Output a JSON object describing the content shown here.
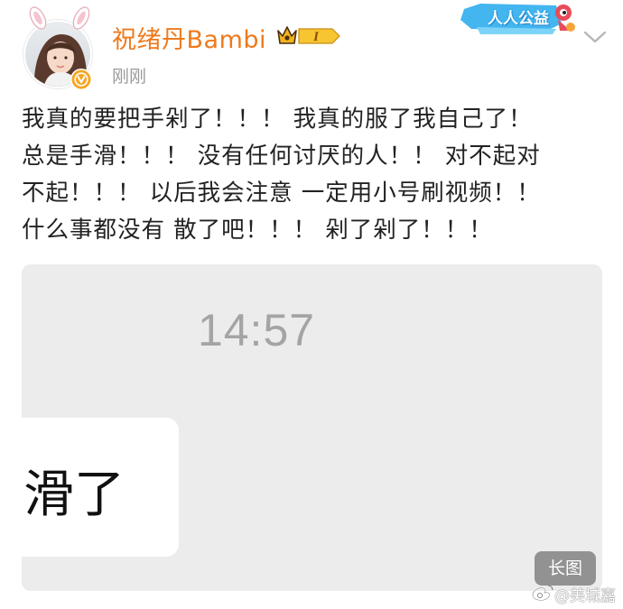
{
  "post": {
    "author": {
      "username": "祝绪丹Bambi",
      "timestamp": "刚刚",
      "vip_level": "I"
    },
    "charity_badge": "人人公益",
    "text_lines": [
      "我真的要把手剁了！！！ 我真的服了我自己了！",
      "总是手滑！！！ 没有任何讨厌的人！！ 对不起对",
      "不起！！！ 以后我会注意 一定用小号刷视频！！",
      "什么事都没有 散了吧！！！ 剁了剁了！！！"
    ],
    "image": {
      "clock_time": "14:57",
      "chat_text": "滑了",
      "tag": "长图"
    },
    "watermark": {
      "text": "@美城嘉"
    }
  },
  "colors": {
    "username": "#ee7a1d",
    "verified": "#f5a623",
    "image_bg": "#ececec"
  },
  "icons": [
    "bunny-ears-icon",
    "verified-badge-icon",
    "crown-icon",
    "more-options-chevron-icon",
    "weibo-logo-icon"
  ]
}
